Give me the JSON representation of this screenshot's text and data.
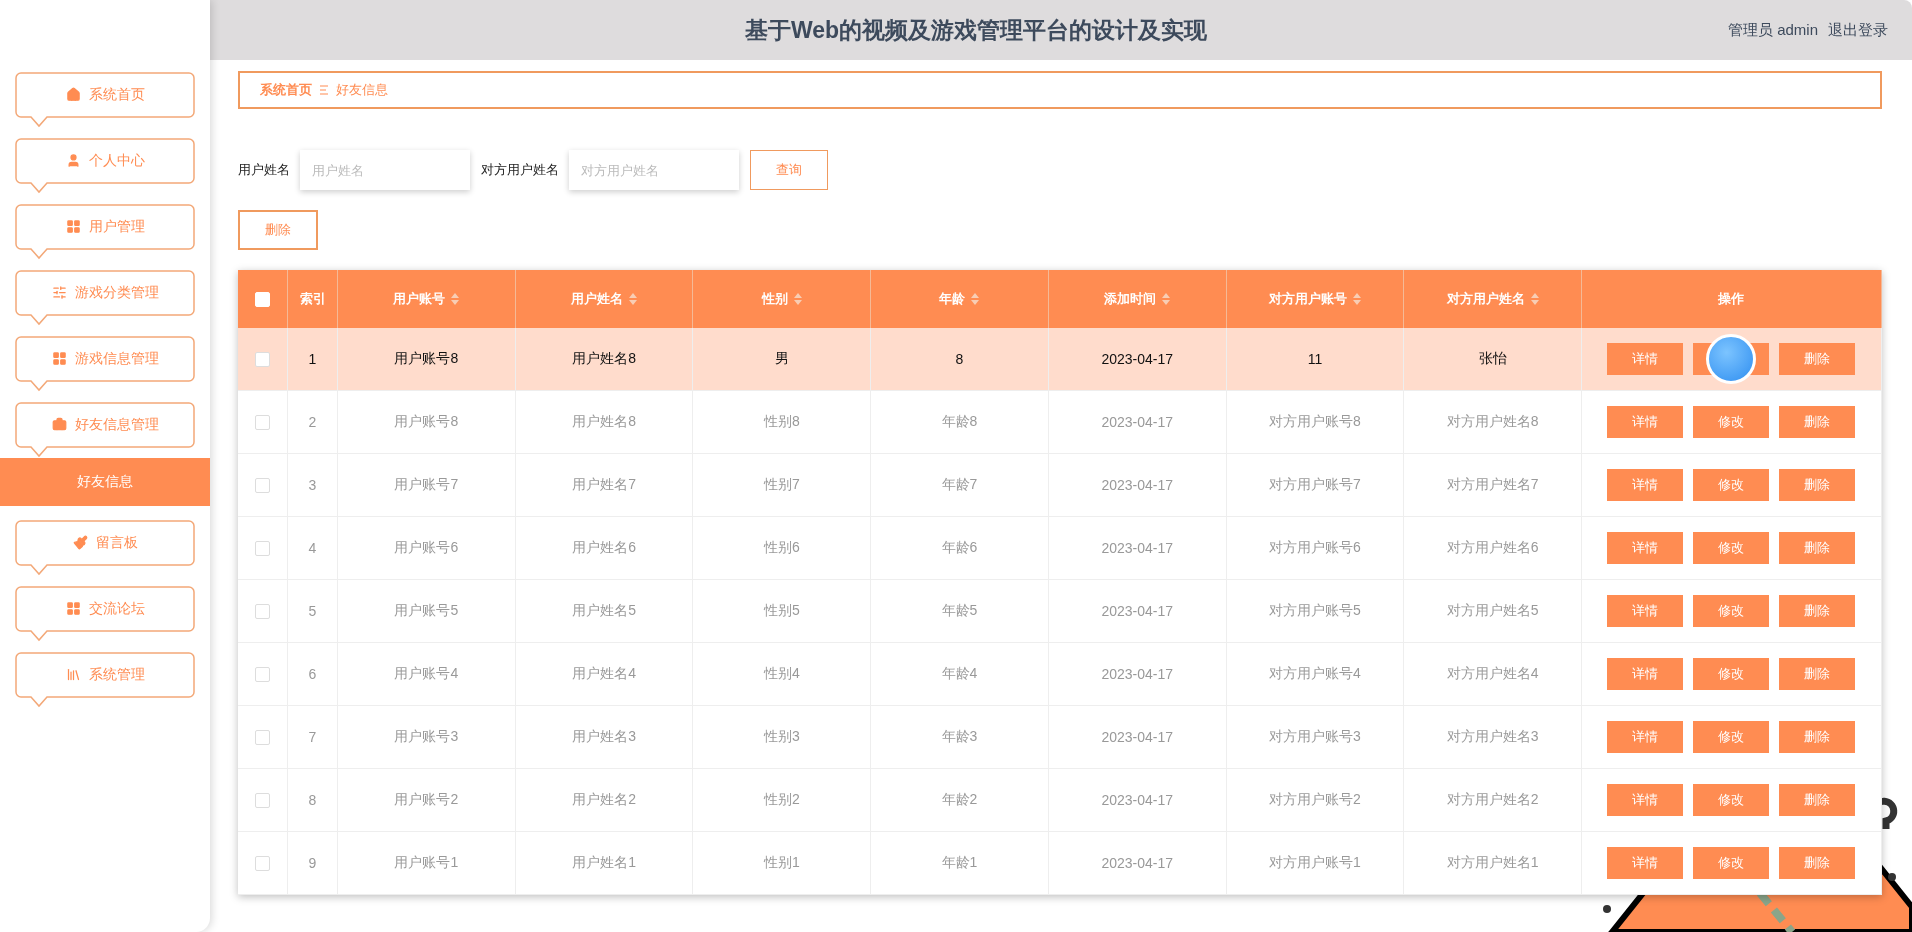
{
  "header": {
    "title": "基于Web的视频及游戏管理平台的设计及实现",
    "user": "管理员 admin",
    "logout": "退出登录"
  },
  "sidebar": {
    "items": [
      {
        "label": "系统首页"
      },
      {
        "label": "个人中心"
      },
      {
        "label": "用户管理"
      },
      {
        "label": "游戏分类管理"
      },
      {
        "label": "游戏信息管理"
      },
      {
        "label": "好友信息管理",
        "children": [
          {
            "label": "好友信息",
            "selected": true
          }
        ]
      },
      {
        "label": "留言板"
      },
      {
        "label": "交流论坛"
      },
      {
        "label": "系统管理"
      }
    ]
  },
  "breadcrumb": [
    "系统首页",
    "好友信息"
  ],
  "search": {
    "fields": [
      {
        "label": "用户姓名",
        "placeholder": "用户姓名"
      },
      {
        "label": "对方用户姓名",
        "placeholder": "对方用户姓名"
      }
    ],
    "button": "查询"
  },
  "delete_button": "删除",
  "table": {
    "header_checked": false,
    "columns": [
      {
        "label": "索引",
        "sortable": false
      },
      {
        "label": "用户账号",
        "sortable": true
      },
      {
        "label": "用户姓名",
        "sortable": true
      },
      {
        "label": "性别",
        "sortable": true
      },
      {
        "label": "年龄",
        "sortable": true
      },
      {
        "label": "添加时间",
        "sortable": true
      },
      {
        "label": "对方用户账号",
        "sortable": true
      },
      {
        "label": "对方用户姓名",
        "sortable": true
      },
      {
        "label": "操作",
        "sortable": false
      }
    ],
    "rows": [
      {
        "selected": true,
        "checked": false,
        "cells": [
          "1",
          "用户账号8",
          "用户姓名8",
          "男",
          "8",
          "2023-04-17",
          "11",
          "张怡"
        ],
        "actions": [
          {
            "kind": "button",
            "label": "详情"
          },
          {
            "kind": "covered"
          },
          {
            "kind": "button",
            "label": "删除"
          }
        ]
      },
      {
        "selected": false,
        "checked": false,
        "cells": [
          "2",
          "用户账号8",
          "用户姓名8",
          "性别8",
          "年龄8",
          "2023-04-17",
          "对方用户账号8",
          "对方用户姓名8"
        ],
        "actions": [
          {
            "kind": "button",
            "label": "详情"
          },
          {
            "kind": "button",
            "label": "修改"
          },
          {
            "kind": "button",
            "label": "删除"
          }
        ]
      },
      {
        "selected": false,
        "checked": false,
        "cells": [
          "3",
          "用户账号7",
          "用户姓名7",
          "性别7",
          "年龄7",
          "2023-04-17",
          "对方用户账号7",
          "对方用户姓名7"
        ],
        "actions": [
          {
            "kind": "button",
            "label": "详情"
          },
          {
            "kind": "button",
            "label": "修改"
          },
          {
            "kind": "button",
            "label": "删除"
          }
        ]
      },
      {
        "selected": false,
        "checked": false,
        "cells": [
          "4",
          "用户账号6",
          "用户姓名6",
          "性别6",
          "年龄6",
          "2023-04-17",
          "对方用户账号6",
          "对方用户姓名6"
        ],
        "actions": [
          {
            "kind": "button",
            "label": "详情"
          },
          {
            "kind": "button",
            "label": "修改"
          },
          {
            "kind": "button",
            "label": "删除"
          }
        ]
      },
      {
        "selected": false,
        "checked": false,
        "cells": [
          "5",
          "用户账号5",
          "用户姓名5",
          "性别5",
          "年龄5",
          "2023-04-17",
          "对方用户账号5",
          "对方用户姓名5"
        ],
        "actions": [
          {
            "kind": "button",
            "label": "详情"
          },
          {
            "kind": "button",
            "label": "修改"
          },
          {
            "kind": "button",
            "label": "删除"
          }
        ]
      },
      {
        "selected": false,
        "checked": false,
        "cells": [
          "6",
          "用户账号4",
          "用户姓名4",
          "性别4",
          "年龄4",
          "2023-04-17",
          "对方用户账号4",
          "对方用户姓名4"
        ],
        "actions": [
          {
            "kind": "button",
            "label": "详情"
          },
          {
            "kind": "button",
            "label": "修改"
          },
          {
            "kind": "button",
            "label": "删除"
          }
        ]
      },
      {
        "selected": false,
        "checked": false,
        "cells": [
          "7",
          "用户账号3",
          "用户姓名3",
          "性别3",
          "年龄3",
          "2023-04-17",
          "对方用户账号3",
          "对方用户姓名3"
        ],
        "actions": [
          {
            "kind": "button",
            "label": "详情"
          },
          {
            "kind": "button",
            "label": "修改"
          },
          {
            "kind": "button",
            "label": "删除"
          }
        ]
      },
      {
        "selected": false,
        "checked": false,
        "cells": [
          "8",
          "用户账号2",
          "用户姓名2",
          "性别2",
          "年龄2",
          "2023-04-17",
          "对方用户账号2",
          "对方用户姓名2"
        ],
        "actions": [
          {
            "kind": "button",
            "label": "详情"
          },
          {
            "kind": "button",
            "label": "修改"
          },
          {
            "kind": "button",
            "label": "删除"
          }
        ]
      },
      {
        "selected": false,
        "checked": false,
        "cells": [
          "9",
          "用户账号1",
          "用户姓名1",
          "性别1",
          "年龄1",
          "2023-04-17",
          "对方用户账号1",
          "对方用户姓名1"
        ],
        "actions": [
          {
            "kind": "button",
            "label": "详情"
          },
          {
            "kind": "button",
            "label": "修改"
          },
          {
            "kind": "button",
            "label": "删除"
          }
        ]
      }
    ]
  }
}
